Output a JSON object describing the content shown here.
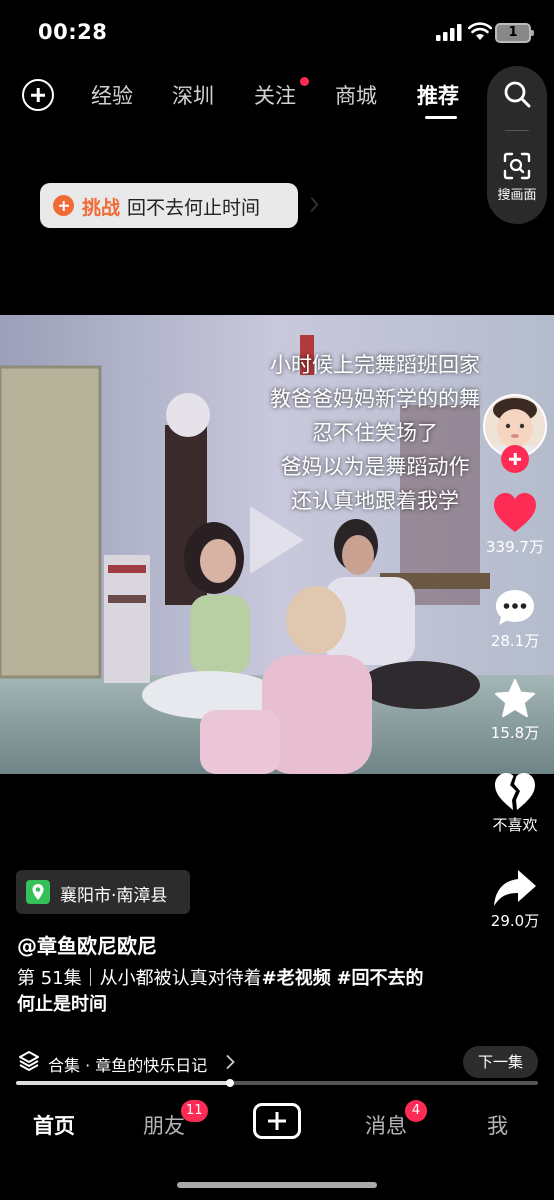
{
  "status_bar": {
    "time": "00:28",
    "battery_level": "1"
  },
  "top_nav": {
    "tabs": [
      {
        "label": "经验"
      },
      {
        "label": "深圳"
      },
      {
        "label": "关注"
      },
      {
        "label": "商城"
      },
      {
        "label": "推荐",
        "active": true
      }
    ],
    "scan_label": "搜画面"
  },
  "challenge": {
    "tag": "挑战",
    "text": "回不去何止时间"
  },
  "video": {
    "caption_lines": [
      "小时候上完舞蹈班回家",
      "教爸爸妈妈新学的的舞",
      "忍不住笑场了",
      "爸妈以为是舞蹈动作",
      "还认真地跟着我学"
    ]
  },
  "actions": {
    "likes": "339.7万",
    "comments": "28.1万",
    "favorites": "15.8万",
    "dislike_label": "不喜欢",
    "shares": "29.0万"
  },
  "location": "襄阳市·南漳县",
  "author": "@章鱼欧尼欧尼",
  "description": {
    "text": "第 51集｜从小都被认真对待着",
    "hashtag_1": "#老视频",
    "hashtag_2": "#回不去的何止是时间"
  },
  "collection": {
    "text": "合集 · 章鱼的快乐日记",
    "next_label": "下一集"
  },
  "progress": {
    "fraction": 0.41
  },
  "bottom_tabs": {
    "home": "首页",
    "friends": "朋友",
    "friends_badge": "11",
    "messages": "消息",
    "messages_badge": "4",
    "me": "我"
  },
  "colors": {
    "like_red": "#fe2c55",
    "challenge_orange": "#f26a35",
    "location_green": "#35c05a"
  }
}
